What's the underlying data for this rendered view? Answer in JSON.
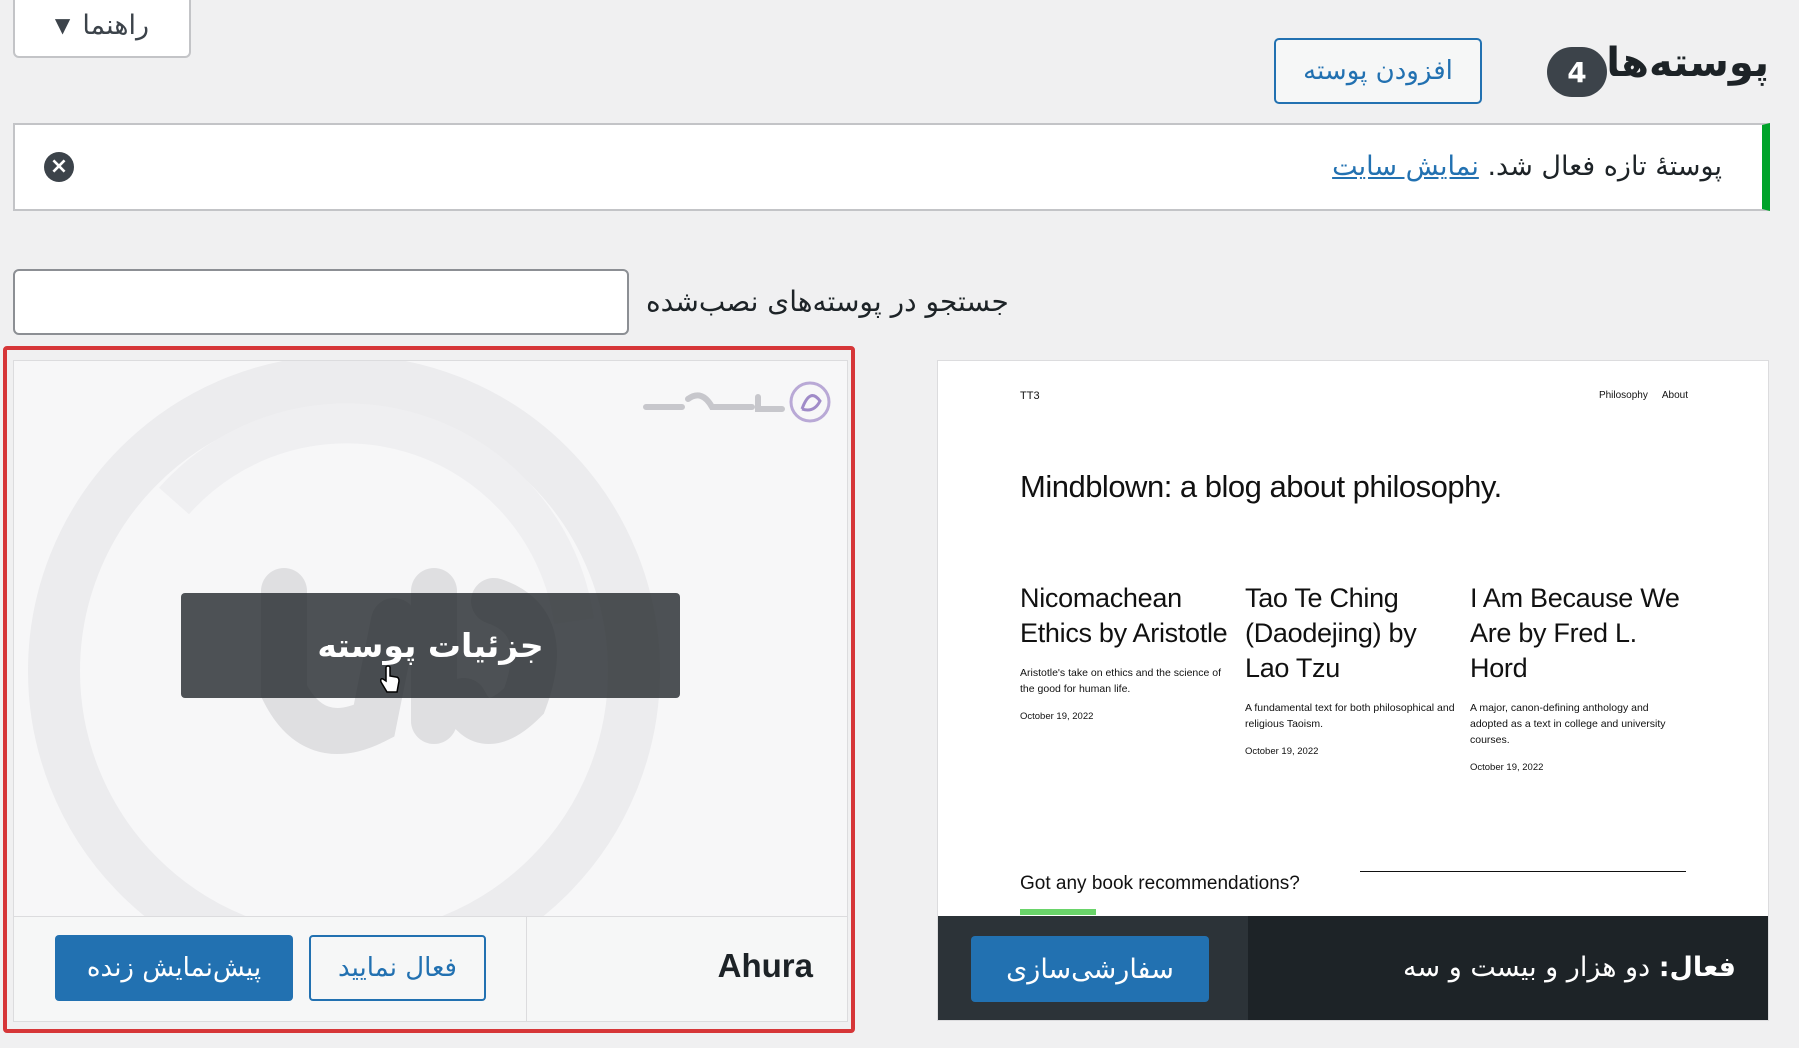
{
  "help_tab": {
    "label": "راهنما",
    "caret_icon": "caret-down-icon"
  },
  "header": {
    "title": "پوسته‌ها",
    "count": "4",
    "add_button": "افزودن پوسته"
  },
  "notice": {
    "message": "پوستهٔ تازه فعال شد.",
    "link": "نمایش سایت"
  },
  "search": {
    "label": "جستجو در پوسته‌های نصب‌شده",
    "value": "",
    "placeholder": ""
  },
  "active_theme": {
    "status_label": "فعال:",
    "name": "دو هزار و بیست و سه",
    "customize_button": "سفارشی‌سازی",
    "screenshot": {
      "site_name": "TT3",
      "nav": [
        "Philosophy",
        "About"
      ],
      "hero": "Mindblown: a blog about philosophy.",
      "posts": [
        {
          "title": "Nicomachean Ethics by Aristotle",
          "desc": "Aristotle's take on ethics and the science of the good for human life.",
          "date": "October 19, 2022"
        },
        {
          "title": "Tao Te Ching (Daodejing) by Lao Tzu",
          "desc": "A fundamental text for both philosophical and religious Taoism.",
          "date": "October 19, 2022"
        },
        {
          "title": "I Am Because We Are by Fred L. Hord",
          "desc": "A major, canon-defining anthology and adopted as a text in college and university courses.",
          "date": "October 19, 2022"
        }
      ],
      "question": "Got any book recommendations?"
    }
  },
  "ahura_theme": {
    "name": "Ahura",
    "details_button": "جزئیات پوسته",
    "activate_button": "فعال نمایید",
    "preview_button": "پیش‌نمایش زنده",
    "highlight_color": "#d63638"
  },
  "colors": {
    "accent": "#2271b1",
    "success": "#00a32a",
    "dark": "#1d2327"
  }
}
